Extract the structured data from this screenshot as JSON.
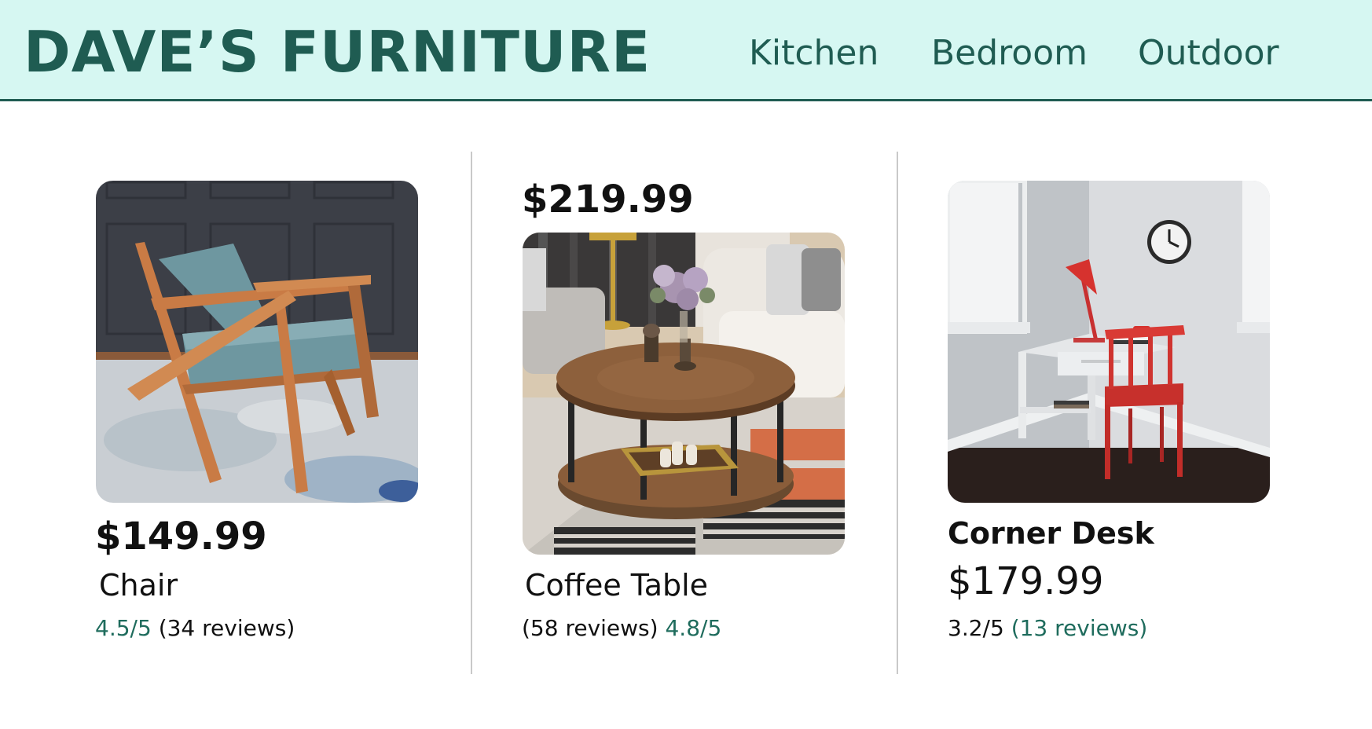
{
  "header": {
    "brand": "DAVE’S FURNITURE",
    "nav": [
      "Kitchen",
      "Bedroom",
      "Outdoor"
    ]
  },
  "colors": {
    "header_bg": "#d6f7f2",
    "accent": "#1f5c52",
    "rating_text": "#1f6c5d",
    "divider": "#c9c9c9"
  },
  "products": [
    {
      "name": "Chair",
      "price": "$149.99",
      "rating": "4.5/5",
      "reviews": "(34 reviews)",
      "image": "armchair-photo"
    },
    {
      "name": "Coffee Table",
      "price": "$219.99",
      "rating": "4.8/5",
      "reviews": "(58 reviews)",
      "image": "coffee-table-photo"
    },
    {
      "name": "Corner Desk",
      "price": "$179.99",
      "rating": "3.2/5",
      "reviews": "(13 reviews)",
      "image": "corner-desk-photo"
    }
  ]
}
